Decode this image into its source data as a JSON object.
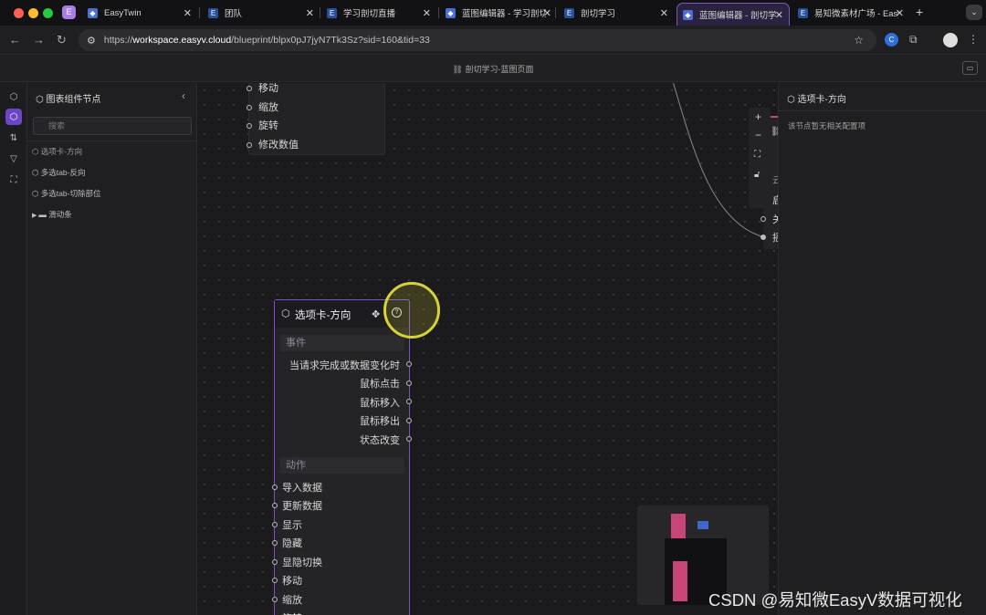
{
  "browser": {
    "tabs": [
      {
        "title": "EasyTwin"
      },
      {
        "title": "团队"
      },
      {
        "title": "学习剖切直播"
      },
      {
        "title": "蓝图编辑器 - 学习剖切"
      },
      {
        "title": "剖切学习"
      },
      {
        "title": "蓝图编辑器 - 剖切学习"
      },
      {
        "title": "易知微素材广场 - EasyV"
      }
    ],
    "app_badge": "E",
    "new_tab": "+",
    "url_host": "workspace.easyv.cloud",
    "url_scheme": "https://",
    "url_path": "/blueprint/blpx0pJ7jyN7Tk3Sz?sid=160&tid=33"
  },
  "app": {
    "title": "剖切学习-蓝图页面"
  },
  "left_panel": {
    "title": "图表组件节点",
    "search_placeholder": "搜索",
    "items": [
      {
        "label": "选项卡-方向"
      },
      {
        "label": "多选tab-反向"
      },
      {
        "label": "多选tab-切除部位"
      },
      {
        "label": "滑动条"
      }
    ]
  },
  "canvas": {
    "top_node_ports": [
      "移动",
      "缩放",
      "旋转",
      "修改数值"
    ],
    "right_node_ports": [
      "启",
      "关",
      "摇"
    ],
    "right_node_lock": "云",
    "main_node": {
      "title": "选项卡-方向",
      "events_label": "事件",
      "events": [
        "当请求完成或数据变化时",
        "鼠标点击",
        "鼠标移入",
        "鼠标移出",
        "状态改变"
      ],
      "actions_label": "动作",
      "actions": [
        "导入数据",
        "更新数据",
        "显示",
        "隐藏",
        "显隐切换",
        "移动",
        "缩放",
        "旋转"
      ]
    },
    "zoom": {
      "in": "+",
      "out": "−",
      "fit": "⛶"
    }
  },
  "right_panel": {
    "title": "选项卡-方向",
    "empty_text": "该节点暂无相关配置项"
  },
  "watermark": "CSDN @易知微EasyV数据可视化",
  "colors": {
    "accent": "#6b46c8",
    "node_border": "#7b4fd0",
    "highlight_ring": "#d8d23a",
    "minimap_pink": "#c8457a",
    "minimap_blue": "#3d68c9"
  }
}
